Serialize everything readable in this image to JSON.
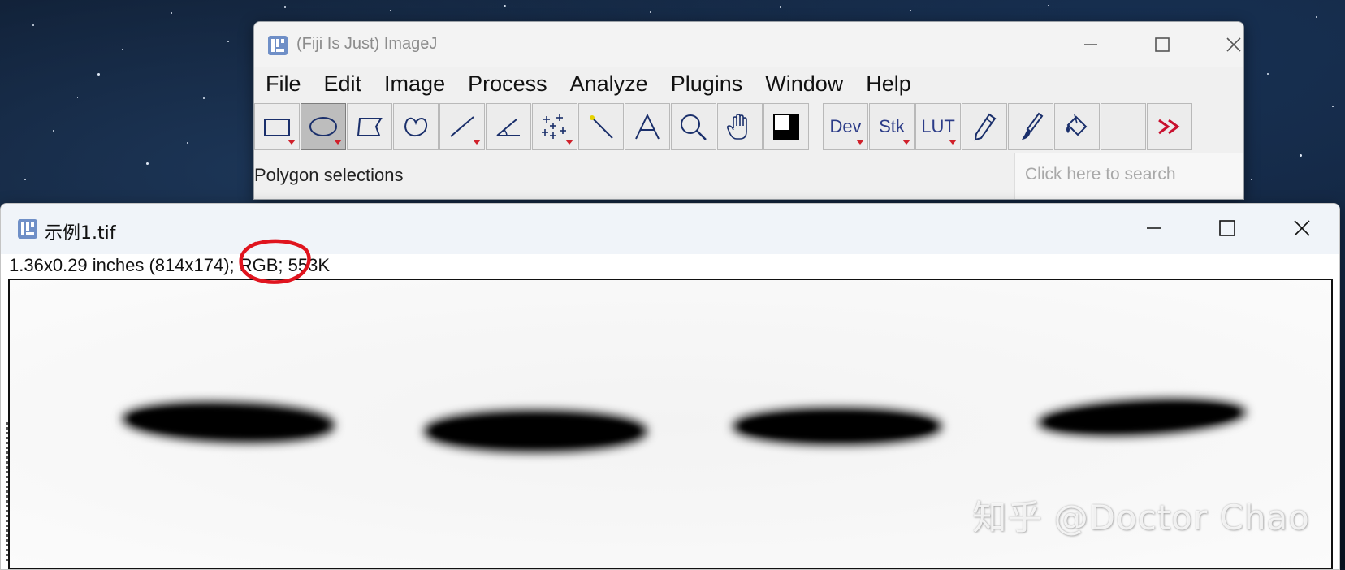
{
  "imagej": {
    "title": "(Fiji Is Just) ImageJ",
    "menu": [
      "File",
      "Edit",
      "Image",
      "Process",
      "Analyze",
      "Plugins",
      "Window",
      "Help"
    ],
    "tools": {
      "dev_label": "Dev",
      "stk_label": "Stk",
      "lut_label": "LUT"
    },
    "status": "Polygon selections",
    "search_placeholder": "Click here to search"
  },
  "image_window": {
    "title": "示例1.tif",
    "info": "1.36x0.29 inches (814x174); RGB; 553K",
    "watermark": "知乎 @Doctor Chao",
    "band_count": 4
  },
  "colors": {
    "annotation": "#e0141e",
    "tool_dropdown_arrow": "#d0202a",
    "more_tools": "#c8102e"
  }
}
